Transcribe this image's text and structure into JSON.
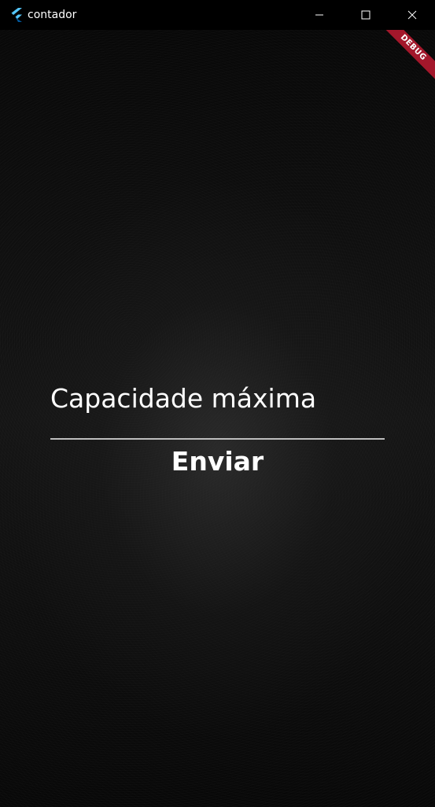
{
  "window": {
    "title": "contador",
    "app_icon": "flutter-logo-icon",
    "controls": [
      "minimize-icon",
      "maximize-icon",
      "close-icon"
    ]
  },
  "debug_banner": {
    "label": "DEBUG",
    "color": "#a3172b"
  },
  "form": {
    "capacity_label": "Capacidade máxima",
    "capacity_value": "",
    "submit_label": "Enviar"
  },
  "colors": {
    "background": "#0d0d0d",
    "text": "#ffffff",
    "underline": "#bdbdbd"
  }
}
